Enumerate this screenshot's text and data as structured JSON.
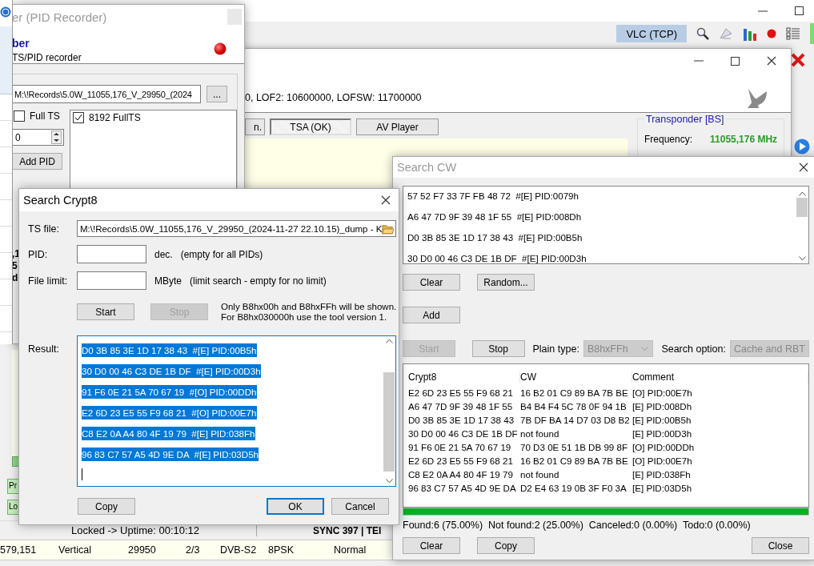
{
  "main_window": {
    "vlc_button": {
      "label": "VLC (TCP)",
      "selected": true
    },
    "side_buttons": [
      "Pr",
      "Lo"
    ],
    "status_bar": {
      "state": "Locked -> Uptime: 00:10:12",
      "sync": "SYNC 397 | TEI"
    },
    "table_row": [
      "579,151",
      "Vertical",
      "29950",
      "2/3",
      "DVB-S2",
      "8PSK",
      "Normal"
    ]
  },
  "pid_recorder": {
    "title": "er (PID Recorder)",
    "heading": "ber",
    "subtitle": "TS/PID recorder",
    "path": "M:\\!Records\\5.0W_11055,176_V_29950_(2024",
    "browse": "...",
    "full_ts": {
      "label": "Full TS",
      "checked": false
    },
    "pid_value": "0",
    "add_pid": "Add PID",
    "pids": [
      {
        "label": "8192 FullTS",
        "checked": true
      }
    ],
    "fragments": [
      ",1",
      "5",
      "d"
    ]
  },
  "tsa_window": {
    "lof_info": "0, LOF2: 10600000, LOFSW: 11700000",
    "tabs": [
      {
        "label": "n.",
        "selected": false
      },
      {
        "label": "TSA (OK)",
        "selected": true
      },
      {
        "label": "AV Player",
        "selected": false
      }
    ],
    "transponder": {
      "title": "Transponder [BS]",
      "frequency_label": "Frequency:",
      "frequency": "11055,176 MHz"
    }
  },
  "search_crypt8": {
    "title": "Search Crypt8",
    "ts_file_label": "TS file:",
    "ts_file": "M:\\!Records\\5.0W_11055,176_V_29950_(2024-11-27 22.10.15)_dump - K",
    "pid_label": "PID:",
    "pid_hint": "dec.   (empty for all PIDs)",
    "limit_label": "File limit:",
    "limit_hint": "MByte   (limit search - empty for no limit)",
    "buttons": [
      {
        "label": "Start",
        "disabled": false
      },
      {
        "label": "Stop",
        "disabled": true
      }
    ],
    "note": [
      "Only B8hx00h and B8hxFFh will be shown.",
      "For B8hx030000h use the tool version 1."
    ],
    "result_label": "Result:",
    "result": {
      "selected": true,
      "lines": [
        "D0 3B 85 3E 1D 17 38 43  #[E] PID:00B5h",
        "30 D0 00 46 C3 DE 1B DF  #[E] PID:00D3h",
        "91 F6 0E 21 5A 70 67 19  #[O] PID:00DDh",
        "E2 6D 23 E5 55 F9 68 21  #[O] PID:00E7h",
        "C8 E2 0A A4 80 4F 19 79  #[E] PID:038Fh",
        "96 83 C7 57 A5 4D 9E DA  #[E] PID:03D5h"
      ]
    },
    "footer": [
      {
        "label": "Copy",
        "focused": false
      },
      {
        "label": "OK",
        "focused": true
      },
      {
        "label": "Cancel",
        "focused": false
      }
    ]
  },
  "search_cw": {
    "title": "Search CW",
    "cw_list": [
      "57 52 F7 33 7F FB 48 72  #[E] PID:0079h",
      "A6 47 7D 9F 39 48 1F 55  #[E] PID:008Dh",
      "D0 3B 85 3E 1D 17 38 43  #[E] PID:00B5h",
      "30 D0 00 46 C3 DE 1B DF  #[E] PID:00D3h"
    ],
    "list_buttons": [
      {
        "label": "Clear",
        "disabled": false
      },
      {
        "label": "Random...",
        "disabled": false
      }
    ],
    "add_button": "Add",
    "run_buttons": [
      {
        "label": "Start",
        "disabled": true
      },
      {
        "label": "Stop",
        "disabled": false
      }
    ],
    "plain_type": {
      "label": "Plain type:",
      "value": "B8hxFFh",
      "disabled": true
    },
    "search_option": {
      "label": "Search option:",
      "value": "Cache and RBT",
      "disabled": true
    },
    "table": {
      "columns": [
        "Crypt8",
        "CW",
        "Comment"
      ],
      "rows": [
        [
          "E2 6D 23 E5 55 F9 68 21",
          "16 B2 01 C9 89 BA 7B BE",
          "[O] PID:00E7h"
        ],
        [
          "A6 47 7D 9F 39 48 1F 55",
          "B4 B4 F4 5C 78 0F 94 1B",
          "[E] PID:008Dh"
        ],
        [
          "D0 3B 85 3E 1D 17 38 43",
          "7B DF BA 14 D7 03 D8 B2",
          "[E] PID:00B5h"
        ],
        [
          "30 D0 00 46 C3 DE 1B DF",
          "not found",
          "[E] PID:00D3h"
        ],
        [
          "91 F6 0E 21 5A 70 67 19",
          "70 D3 0E 51 1B DB 99 8F",
          "[O] PID:00DDh"
        ],
        [
          "E2 6D 23 E5 55 F9 68 21",
          "16 B2 01 C9 89 BA 7B BE",
          "[O] PID:00E7h"
        ],
        [
          "C8 E2 0A A4 80 4F 19 79",
          "not found",
          "[E] PID:038Fh"
        ],
        [
          "96 83 C7 57 A5 4D 9E DA",
          "D2 E4 63 19 0B 3F F0 3A",
          "[E] PID:03D5h"
        ]
      ]
    },
    "progress": {
      "level": 1
    },
    "summary": "Found:6 (75.00%)  Not found:2 (25.00%)  Canceled:0 (0.00%)  Todo:0 (0.00%)",
    "footer": [
      {
        "label": "Clear"
      },
      {
        "label": "Copy"
      },
      {
        "label": "Close"
      }
    ]
  }
}
